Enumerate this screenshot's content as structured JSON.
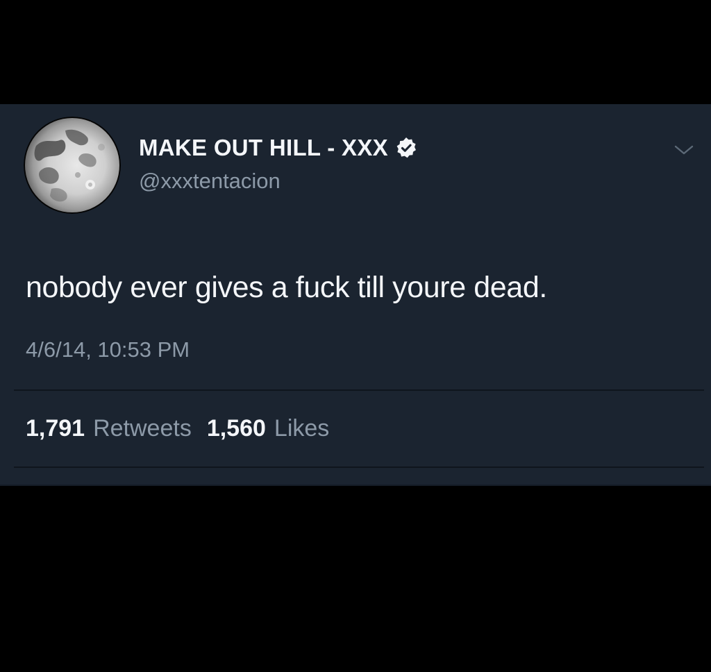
{
  "tweet": {
    "display_name": "MAKE OUT HILL - XXX",
    "handle": "@xxxtentacion",
    "text": "nobody ever gives a fuck till youre dead.",
    "timestamp": "4/6/14, 10:53 PM",
    "retweets_count": "1,791",
    "retweets_label": "Retweets",
    "likes_count": "1,560",
    "likes_label": "Likes",
    "verified": true,
    "avatar_icon": "moon-avatar",
    "menu_icon": "chevron-down-icon"
  },
  "colors": {
    "page_background": "#000000",
    "card_background": "#1b2430",
    "primary_text": "#f4f6f9",
    "secondary_text": "#8d9aa8"
  }
}
